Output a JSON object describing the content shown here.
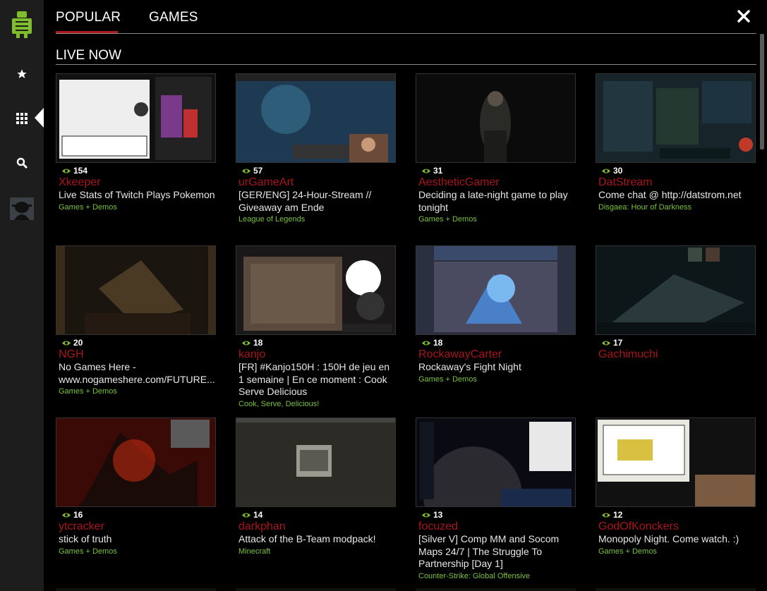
{
  "nav": {
    "tabs": [
      {
        "label": "POPULAR",
        "active": true
      },
      {
        "label": "GAMES",
        "active": false
      }
    ],
    "close_icon": "close-icon"
  },
  "section": {
    "title": "LIVE NOW"
  },
  "rail": {
    "items": [
      {
        "icon": "android-logo-icon"
      },
      {
        "icon": "star-icon"
      },
      {
        "icon": "grid-icon",
        "active": true
      },
      {
        "icon": "search-icon"
      },
      {
        "icon": "avatar"
      }
    ],
    "accent": "#7fbd2c"
  },
  "colors": {
    "streamer": "#a8151b",
    "game": "#79c23c",
    "tab_underline": "#b0191e"
  },
  "streams": [
    {
      "viewers": "154",
      "streamer": "Xkeeper",
      "status": "Live Stats of Twitch Plays Pokemon",
      "game": "Games + Demos"
    },
    {
      "viewers": "57",
      "streamer": "urGameArt",
      "status": "[GER/ENG] 24-Hour-Stream // Giveaway am Ende",
      "game": "League of Legends"
    },
    {
      "viewers": "31",
      "streamer": "AestheticGamer",
      "status": "Deciding a late-night game to play tonight",
      "game": "Games + Demos"
    },
    {
      "viewers": "30",
      "streamer": "DatStream",
      "status": "Come chat @ http://datstrom.net",
      "game": "Disgaea: Hour of Darkness"
    },
    {
      "viewers": "20",
      "streamer": "NGH",
      "status": "No Games Here - www.nogameshere.com/FUTURE...",
      "game": "Games + Demos"
    },
    {
      "viewers": "18",
      "streamer": "kanjo",
      "status": "[FR] #Kanjo150H : 150H de jeu en 1 semaine | En ce moment : Cook Serve Delicious",
      "game": "Cook, Serve, Delicious!"
    },
    {
      "viewers": "18",
      "streamer": "RockawayCarter",
      "status": "Rockaway's Fight Night",
      "game": "Games + Demos"
    },
    {
      "viewers": "17",
      "streamer": "Gachimuchi",
      "status": "",
      "game": ""
    },
    {
      "viewers": "16",
      "streamer": "ytcracker",
      "status": "stick of truth",
      "game": "Games + Demos"
    },
    {
      "viewers": "14",
      "streamer": "darkphan",
      "status": "Attack of the B-Team modpack!",
      "game": "Minecraft"
    },
    {
      "viewers": "13",
      "streamer": "focuzed",
      "status": "[Silver V] Comp MM and Socom Maps 24/7 | The Struggle To Partnership [Day 1]",
      "game": "Counter-Strike: Global Offensive"
    },
    {
      "viewers": "12",
      "streamer": "GodOfKonckers",
      "status": "Monopoly Night. Come watch. :)",
      "game": "Games + Demos"
    }
  ]
}
